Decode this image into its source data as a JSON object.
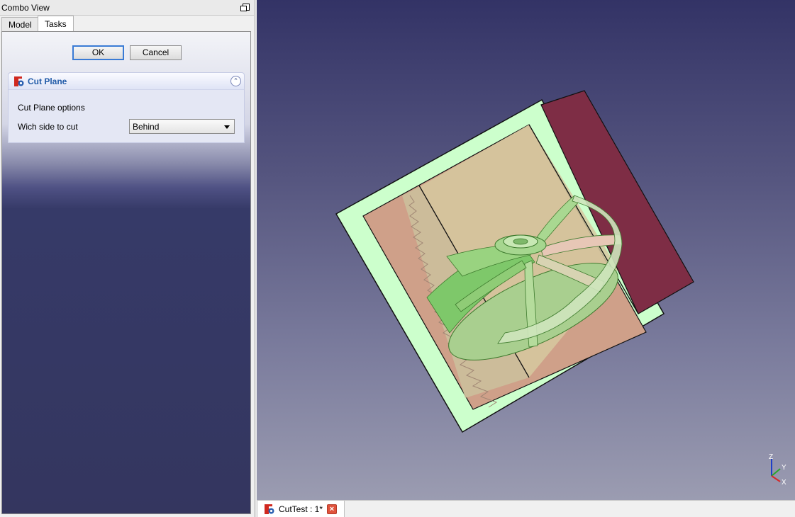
{
  "combo": {
    "title": "Combo View",
    "tabs": [
      {
        "label": "Model",
        "active": false
      },
      {
        "label": "Tasks",
        "active": true
      }
    ]
  },
  "tasks": {
    "ok_label": "OK",
    "cancel_label": "Cancel",
    "panel": {
      "title": "Cut Plane",
      "options_label": "Cut Plane options",
      "side_label": "Wich side to cut",
      "side_value": "Behind",
      "collapse_icon": "chevron-double-up-icon"
    }
  },
  "viewport": {
    "axes": {
      "z": "Z",
      "y": "Y",
      "x": "X"
    },
    "colors": {
      "plane_fill": "#ccffcc",
      "cut_region": "#7e2d45",
      "part": "#7ec86a",
      "frame": "#d4b8a2"
    }
  },
  "document_tab": {
    "title": "CutTest : 1*",
    "close_icon": "close-icon"
  },
  "icons": {
    "freecad": "freecad-logo-icon",
    "float": "float-window-icon",
    "dropdown": "chevron-down-icon"
  }
}
